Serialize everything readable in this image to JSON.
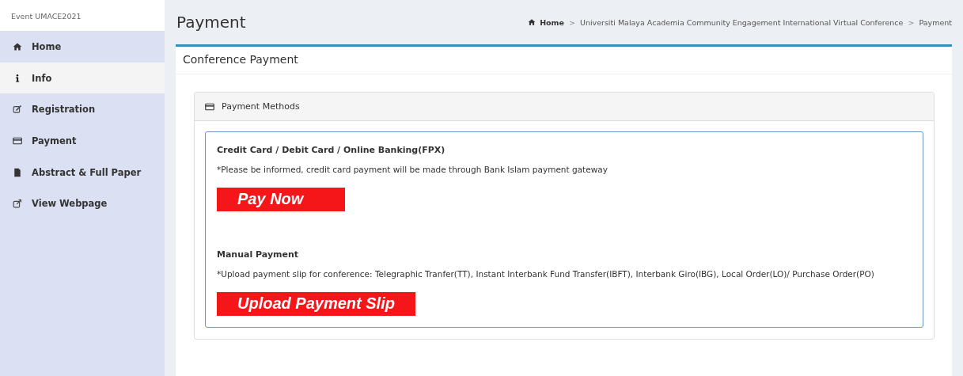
{
  "sidebar": {
    "event_title": "Event UMACE2021",
    "items": [
      {
        "label": "Home",
        "kind": "home",
        "selected": false
      },
      {
        "label": "Info",
        "kind": "info",
        "selected": true
      },
      {
        "label": "Registration",
        "kind": "edit",
        "selected": false
      },
      {
        "label": "Payment",
        "kind": "card",
        "selected": false
      },
      {
        "label": "Abstract & Full Paper",
        "kind": "file",
        "selected": false
      },
      {
        "label": "View Webpage",
        "kind": "external",
        "selected": false
      }
    ]
  },
  "page": {
    "title": "Payment",
    "breadcrumb": [
      {
        "label": "Home",
        "kind": "home"
      },
      {
        "label": "Universiti Malaya Academia Community Engagement International Virtual Conference",
        "kind": "plain"
      },
      {
        "label": "Payment",
        "kind": "plain"
      }
    ],
    "separator": ">"
  },
  "box": {
    "title": "Conference Payment",
    "panel_title": "Payment Methods",
    "methods": [
      {
        "title": "Credit Card / Debit Card / Online Banking(FPX)",
        "note": "*Please be informed, credit card payment will be made through Bank Islam payment gateway",
        "button": "Pay Now"
      },
      {
        "title": "Manual Payment",
        "note": "*Upload payment slip for conference: Telegraphic Tranfer(TT), Instant Interbank Fund Transfer(IBFT), Interbank Giro(IBG), Local Order(LO)/ Purchase Order(PO)",
        "button": "Upload Payment Slip"
      }
    ]
  }
}
